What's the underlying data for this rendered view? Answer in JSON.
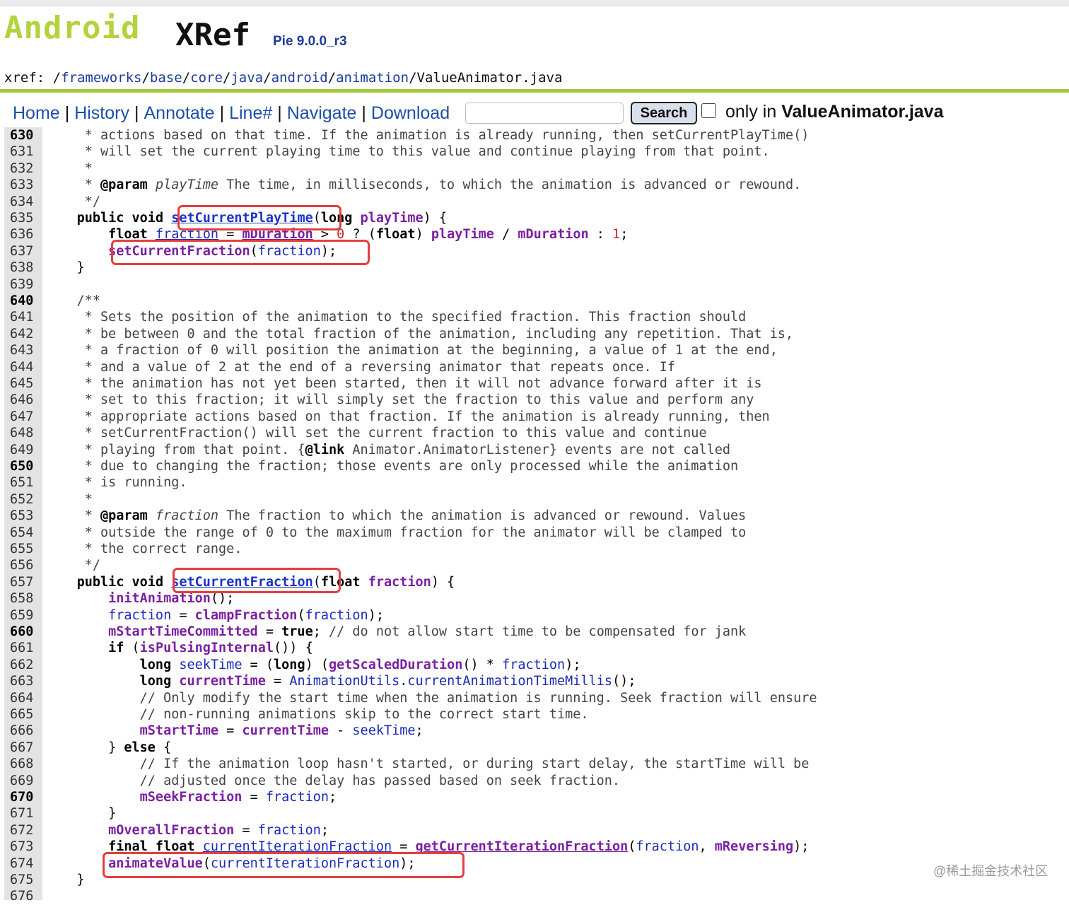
{
  "logo": {
    "android": "Android",
    "xref": "XRef",
    "version": "Pie 9.0.0_r3"
  },
  "breadcrumb": {
    "prefix": "xref: /",
    "segments": [
      "frameworks",
      "base",
      "core",
      "java",
      "android",
      "animation",
      "ValueAnimator.java"
    ]
  },
  "nav": {
    "items": [
      "Home",
      "History",
      "Annotate",
      "Line#",
      "Navigate",
      "Download"
    ]
  },
  "search": {
    "button_label": "Search",
    "only_in_prefix": "only in ",
    "only_in_file": "ValueAnimator.java"
  },
  "code": {
    "first_line": 630,
    "bold_line_numbers": [
      630,
      640,
      650,
      660,
      670
    ],
    "lines": [
      [
        [
          "c",
          "     * actions based on that time. If the animation is already running, then setCurrentPlayTime()"
        ]
      ],
      [
        [
          "c",
          "     * will set the current playing time to this value and continue playing from that point."
        ]
      ],
      [
        [
          "c",
          "     *"
        ]
      ],
      [
        [
          "c",
          "     * "
        ],
        [
          "tag",
          "@param"
        ],
        [
          "c",
          " "
        ],
        [
          "ci",
          "playTime"
        ],
        [
          "c",
          " The time, in milliseconds, to which the animation is advanced or rewound."
        ]
      ],
      [
        [
          "c",
          "     */"
        ]
      ],
      [
        [
          "p",
          "    "
        ],
        [
          "k",
          "public void"
        ],
        [
          "p",
          " "
        ],
        [
          "m",
          "setCurrentPlayTime"
        ],
        [
          "p",
          "("
        ],
        [
          "k",
          "long"
        ],
        [
          "p",
          " "
        ],
        [
          "f",
          "playTime"
        ],
        [
          "p",
          ") {"
        ]
      ],
      [
        [
          "p",
          "        "
        ],
        [
          "k",
          "float"
        ],
        [
          "p",
          " "
        ],
        [
          "vu",
          "fraction"
        ],
        [
          "p",
          " = "
        ],
        [
          "fu",
          "mDuration"
        ],
        [
          "p",
          " > "
        ],
        [
          "n",
          "0"
        ],
        [
          "p",
          " ? ("
        ],
        [
          "k",
          "float"
        ],
        [
          "p",
          ") "
        ],
        [
          "f",
          "playTime"
        ],
        [
          "p",
          " / "
        ],
        [
          "f",
          "mDuration"
        ],
        [
          "p",
          " : "
        ],
        [
          "n",
          "1"
        ],
        [
          "p",
          ";"
        ]
      ],
      [
        [
          "p",
          "        "
        ],
        [
          "f",
          "setCurrentFraction"
        ],
        [
          "p",
          "("
        ],
        [
          "v",
          "fraction"
        ],
        [
          "p",
          ");"
        ]
      ],
      [
        [
          "p",
          "    }"
        ]
      ],
      [
        [
          "p",
          ""
        ]
      ],
      [
        [
          "c",
          "    /**"
        ]
      ],
      [
        [
          "c",
          "     * Sets the position of the animation to the specified fraction. This fraction should"
        ]
      ],
      [
        [
          "c",
          "     * be between 0 and the total fraction of the animation, including any repetition. That is,"
        ]
      ],
      [
        [
          "c",
          "     * a fraction of 0 will position the animation at the beginning, a value of 1 at the end,"
        ]
      ],
      [
        [
          "c",
          "     * and a value of 2 at the end of a reversing animator that repeats once. If"
        ]
      ],
      [
        [
          "c",
          "     * the animation has not yet been started, then it will not advance forward after it is"
        ]
      ],
      [
        [
          "c",
          "     * set to this fraction; it will simply set the fraction to this value and perform any"
        ]
      ],
      [
        [
          "c",
          "     * appropriate actions based on that fraction. If the animation is already running, then"
        ]
      ],
      [
        [
          "c",
          "     * setCurrentFraction() will set the current fraction to this value and continue"
        ]
      ],
      [
        [
          "c",
          "     * playing from that point. {"
        ],
        [
          "tag",
          "@link"
        ],
        [
          "c",
          " Animator.AnimatorListener} events are not called"
        ]
      ],
      [
        [
          "c",
          "     * due to changing the fraction; those events are only processed while the animation"
        ]
      ],
      [
        [
          "c",
          "     * is running."
        ]
      ],
      [
        [
          "c",
          "     *"
        ]
      ],
      [
        [
          "c",
          "     * "
        ],
        [
          "tag",
          "@param"
        ],
        [
          "c",
          " "
        ],
        [
          "ci",
          "fraction"
        ],
        [
          "c",
          " The fraction to which the animation is advanced or rewound. Values"
        ]
      ],
      [
        [
          "c",
          "     * outside the range of 0 to the maximum fraction for the animator will be clamped to"
        ]
      ],
      [
        [
          "c",
          "     * the correct range."
        ]
      ],
      [
        [
          "c",
          "     */"
        ]
      ],
      [
        [
          "p",
          "    "
        ],
        [
          "k",
          "public void"
        ],
        [
          "p",
          " "
        ],
        [
          "m",
          "setCurrentFraction"
        ],
        [
          "p",
          "("
        ],
        [
          "k",
          "float"
        ],
        [
          "p",
          " "
        ],
        [
          "f",
          "fraction"
        ],
        [
          "p",
          ") {"
        ]
      ],
      [
        [
          "p",
          "        "
        ],
        [
          "f",
          "initAnimation"
        ],
        [
          "p",
          "();"
        ]
      ],
      [
        [
          "p",
          "        "
        ],
        [
          "v",
          "fraction"
        ],
        [
          "p",
          " = "
        ],
        [
          "f",
          "clampFraction"
        ],
        [
          "p",
          "("
        ],
        [
          "v",
          "fraction"
        ],
        [
          "p",
          ");"
        ]
      ],
      [
        [
          "p",
          "        "
        ],
        [
          "f",
          "mStartTimeCommitted"
        ],
        [
          "p",
          " = "
        ],
        [
          "k",
          "true"
        ],
        [
          "p",
          "; "
        ],
        [
          "c",
          "// do not allow start time to be compensated for jank"
        ]
      ],
      [
        [
          "p",
          "        "
        ],
        [
          "k",
          "if"
        ],
        [
          "p",
          " ("
        ],
        [
          "f",
          "isPulsingInternal"
        ],
        [
          "p",
          "()) {"
        ]
      ],
      [
        [
          "p",
          "            "
        ],
        [
          "k",
          "long"
        ],
        [
          "p",
          " "
        ],
        [
          "v",
          "seekTime"
        ],
        [
          "p",
          " = ("
        ],
        [
          "k",
          "long"
        ],
        [
          "p",
          ") ("
        ],
        [
          "f",
          "getScaledDuration"
        ],
        [
          "p",
          "() * "
        ],
        [
          "v",
          "fraction"
        ],
        [
          "p",
          ");"
        ]
      ],
      [
        [
          "p",
          "            "
        ],
        [
          "k",
          "long"
        ],
        [
          "p",
          " "
        ],
        [
          "f",
          "currentTime"
        ],
        [
          "p",
          " = "
        ],
        [
          "v",
          "AnimationUtils"
        ],
        [
          "p",
          "."
        ],
        [
          "v",
          "currentAnimationTimeMillis"
        ],
        [
          "p",
          "();"
        ]
      ],
      [
        [
          "c",
          "            // Only modify the start time when the animation is running. Seek fraction will ensure"
        ]
      ],
      [
        [
          "c",
          "            // non-running animations skip to the correct start time."
        ]
      ],
      [
        [
          "p",
          "            "
        ],
        [
          "f",
          "mStartTime"
        ],
        [
          "p",
          " = "
        ],
        [
          "f",
          "currentTime"
        ],
        [
          "p",
          " - "
        ],
        [
          "v",
          "seekTime"
        ],
        [
          "p",
          ";"
        ]
      ],
      [
        [
          "p",
          "        } "
        ],
        [
          "k",
          "else"
        ],
        [
          "p",
          " {"
        ]
      ],
      [
        [
          "c",
          "            // If the animation loop hasn't started, or during start delay, the startTime will be"
        ]
      ],
      [
        [
          "c",
          "            // adjusted once the delay has passed based on seek fraction."
        ]
      ],
      [
        [
          "p",
          "            "
        ],
        [
          "f",
          "mSeekFraction"
        ],
        [
          "p",
          " = "
        ],
        [
          "v",
          "fraction"
        ],
        [
          "p",
          ";"
        ]
      ],
      [
        [
          "p",
          "        }"
        ]
      ],
      [
        [
          "p",
          "        "
        ],
        [
          "f",
          "mOverallFraction"
        ],
        [
          "p",
          " = "
        ],
        [
          "v",
          "fraction"
        ],
        [
          "p",
          ";"
        ]
      ],
      [
        [
          "p",
          "        "
        ],
        [
          "k",
          "final float"
        ],
        [
          "p",
          " "
        ],
        [
          "vu",
          "currentIterationFraction"
        ],
        [
          "p",
          " = "
        ],
        [
          "fu",
          "getCurrentIterationFraction"
        ],
        [
          "p",
          "("
        ],
        [
          "v",
          "fraction"
        ],
        [
          "p",
          ", "
        ],
        [
          "f",
          "mReversing"
        ],
        [
          "p",
          ");"
        ]
      ],
      [
        [
          "p",
          "        "
        ],
        [
          "f",
          "animateValue"
        ],
        [
          "p",
          "("
        ],
        [
          "v",
          "currentIterationFraction"
        ],
        [
          "p",
          ");"
        ]
      ],
      [
        [
          "p",
          "    }"
        ]
      ],
      [
        [
          "p",
          ""
        ]
      ]
    ]
  },
  "highlights": {
    "color": "#e53e3e"
  },
  "watermark": "@稀土掘金技术社区",
  "colors": {
    "accent_green": "#a4c83c",
    "link_blue": "#1d4fa8",
    "field_purple": "#7b1fa2",
    "number_red": "#c62828"
  }
}
